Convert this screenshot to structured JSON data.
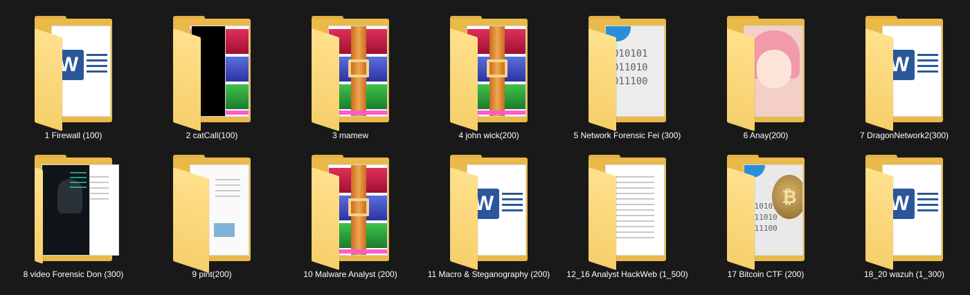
{
  "folders": [
    {
      "name": "1 Firewall (100)",
      "thumbnail": "word-document-icon"
    },
    {
      "name": "2 catCall(100)",
      "thumbnail": "black-image-and-winrar-icon"
    },
    {
      "name": "3 mamew",
      "thumbnail": "winrar-archive-icon"
    },
    {
      "name": "4 john wick(200)",
      "thumbnail": "winrar-archive-icon"
    },
    {
      "name": "5 Network Forensic Fei (300)",
      "thumbnail": "binary-file-icon"
    },
    {
      "name": "6 Anay(200)",
      "thumbnail": "anime-picture-thumbnail"
    },
    {
      "name": "7 DragonNetwork2(300)",
      "thumbnail": "word-document-icon"
    },
    {
      "name": "8 video Forensic Don (300)",
      "thumbnail": "hacker-video-thumbnail"
    },
    {
      "name": "9 pint(200)",
      "thumbnail": "text-and-image-document-icon"
    },
    {
      "name": "10 Malware Analyst (200)",
      "thumbnail": "winrar-archive-icon"
    },
    {
      "name": "11 Macro & Steganography (200)",
      "thumbnail": "word-document-icon"
    },
    {
      "name": "12_16 Analyst HackWeb (1_500)",
      "thumbnail": "text-document-icon"
    },
    {
      "name": "17 Bitcoin CTF (200)",
      "thumbnail": "bitcoin-and-binary-icon"
    },
    {
      "name": "18_20 wazuh (1_300)",
      "thumbnail": "word-document-icon"
    }
  ],
  "binary_text": "010101\n011010\n011100",
  "word_letter": "W",
  "bitcoin_symbol": "₿",
  "colors": {
    "background": "#191919",
    "folder": "#f6cf6b",
    "word": "#2b579a",
    "label": "#ffffff"
  }
}
